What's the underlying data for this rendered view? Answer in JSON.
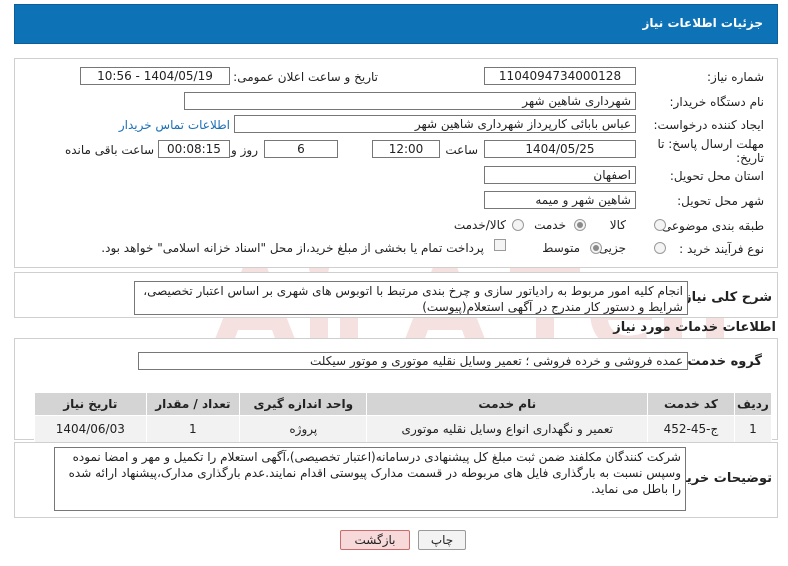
{
  "header": {
    "title": "جزئیات اطلاعات نیاز"
  },
  "form": {
    "need_number_label": "شماره نیاز:",
    "need_number": "1104094734000128",
    "announce_label": "تاریخ و ساعت اعلان عمومی:",
    "announce_value": "1404/05/19 - 10:56",
    "buyer_org_label": "نام دستگاه خریدار:",
    "buyer_org": "شهرداری شاهین شهر",
    "creator_label": "ایجاد کننده درخواست:",
    "creator": "عباس بابائی کارپرداز شهرداری شاهین شهر",
    "buyer_contact_link": "اطلاعات تماس خریدار",
    "deadline_label": "مهلت ارسال پاسخ: تا تاریخ:",
    "deadline_date": "1404/05/25",
    "time_label": "ساعت",
    "deadline_time": "12:00",
    "days_value": "6",
    "days_label": "روز و",
    "remaining_time": "00:08:15",
    "remaining_label": "ساعت باقی مانده",
    "province_label": "استان محل تحویل:",
    "province": "اصفهان",
    "city_label": "شهر محل تحویل:",
    "city": "شاهین شهر و میمه",
    "category_label": "طبقه بندی موضوعی:",
    "category_options": [
      "کالا",
      "خدمت",
      "کالا/خدمت"
    ],
    "category_selected": "خدمت",
    "process_label": "نوع فرآیند خرید :",
    "process_options": [
      "جزیی",
      "متوسط"
    ],
    "process_selected": "متوسط",
    "payment_text": "پرداخت تمام یا بخشی از مبلغ خرید،از محل \"اسناد خزانه اسلامی\" خواهد بود."
  },
  "description": {
    "label": "شرح کلی نیاز:",
    "text": "انجام کلیه امور مربوط به رادیاتور سازی و چرخ بندی مرتبط با اتوبوس های شهری بر اساس اعتبار تخصیصی، شرایط و دستور کار مندرج در آگهی استعلام(پیوست)"
  },
  "services": {
    "section_title": "اطلاعات خدمات مورد نیاز",
    "group_label": "گروه خدمت:",
    "group_value": "عمده فروشی و خرده فروشی ؛ تعمیر وسایل نقلیه موتوری و موتور سیکلت",
    "table": {
      "headers": [
        "ردیف",
        "کد خدمت",
        "نام خدمت",
        "واحد اندازه گیری",
        "تعداد / مقدار",
        "تاریخ نیاز"
      ],
      "rows": [
        [
          "1",
          "ج-45-452",
          "تعمیر و نگهداری انواع وسایل نقلیه موتوری",
          "پروژه",
          "1",
          "1404/06/03"
        ]
      ]
    }
  },
  "buyer_notes": {
    "label": "توضیحات خریدار:",
    "text": "شرکت کنندگان مکلفند ضمن ثبت مبلغ کل پیشنهادی درسامانه(اعتبار تخصیصی)،آگهی استعلام را  تکمیل و مهر و امضا نموده وسپس نسبت به بارگذاری فایل های مربوطه در قسمت مدارک پیوستی اقدام نمایند.عدم بارگذاری مدارک،پیشنهاد ارائه شده را باطل می نماید."
  },
  "buttons": {
    "print": "چاپ",
    "back": "بازگشت"
  },
  "colors": {
    "header_bg": "#0e72b7",
    "back_button_bg": "#f8d9d9",
    "back_button_border": "#cc6b6b",
    "watermark": "#c0392b"
  }
}
